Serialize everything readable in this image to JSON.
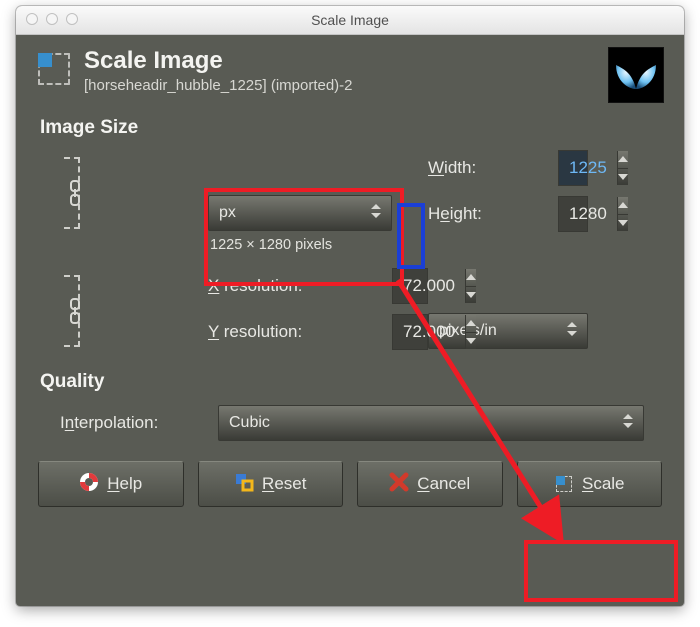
{
  "titlebar": {
    "title": "Scale Image"
  },
  "header": {
    "title": "Scale Image",
    "subtitle": "[horseheadir_hubble_1225] (imported)-2"
  },
  "image_size": {
    "section_label": "Image Size",
    "width_label": "Width:",
    "height_label": "Height:",
    "width_value": "1225",
    "height_value": "1280",
    "unit_options_selected": "px",
    "hint": "1225 × 1280 pixels",
    "link_aspect": true
  },
  "resolution": {
    "x_label": "X resolution:",
    "y_label": "Y resolution:",
    "x_value": "72.000",
    "y_value": "72.000",
    "unit_selected": "pixels/in",
    "link_resolution": true
  },
  "quality": {
    "section_label": "Quality",
    "interp_label": "Interpolation:",
    "interp_selected": "Cubic"
  },
  "buttons": {
    "help": "Help",
    "reset": "Reset",
    "cancel": "Cancel",
    "scale": "Scale"
  },
  "colors": {
    "annotation_red": "#ee1c25",
    "annotation_blue": "#1b3fd6"
  }
}
